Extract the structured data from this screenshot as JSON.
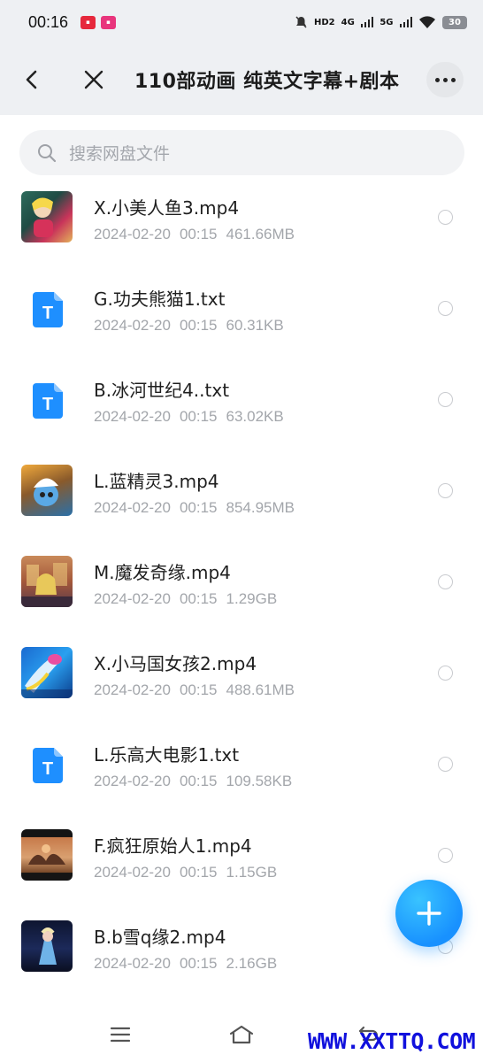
{
  "status_bar": {
    "time": "00:16",
    "indicators": [
      "HD2",
      "4G",
      "5G"
    ],
    "battery": "30"
  },
  "header": {
    "title": "110部动画 纯英文字幕+剧本",
    "back_icon": "back-arrow-icon",
    "close_icon": "close-icon",
    "more_icon": "more-dots-icon"
  },
  "search": {
    "placeholder": "搜索网盘文件"
  },
  "files": [
    {
      "name": "X.小美人鱼3.mp4",
      "date": "2024-02-20",
      "time": "00:15",
      "size": "461.66MB",
      "type": "video"
    },
    {
      "name": "G.功夫熊猫1.txt",
      "date": "2024-02-20",
      "time": "00:15",
      "size": "60.31KB",
      "type": "txt"
    },
    {
      "name": "B.冰河世纪4..txt",
      "date": "2024-02-20",
      "time": "00:15",
      "size": "63.02KB",
      "type": "txt"
    },
    {
      "name": "L.蓝精灵3.mp4",
      "date": "2024-02-20",
      "time": "00:15",
      "size": "854.95MB",
      "type": "video"
    },
    {
      "name": "M.魔发奇缘.mp4",
      "date": "2024-02-20",
      "time": "00:15",
      "size": "1.29GB",
      "type": "video"
    },
    {
      "name": "X.小马国女孩2.mp4",
      "date": "2024-02-20",
      "time": "00:15",
      "size": "488.61MB",
      "type": "video"
    },
    {
      "name": "L.乐高大电影1.txt",
      "date": "2024-02-20",
      "time": "00:15",
      "size": "109.58KB",
      "type": "txt"
    },
    {
      "name": "F.疯狂原始人1.mp4",
      "date": "2024-02-20",
      "time": "00:15",
      "size": "1.15GB",
      "type": "video"
    },
    {
      "name": "B.b雪q缘2.mp4",
      "date": "2024-02-20",
      "time": "00:15",
      "size": "2.16GB",
      "type": "video"
    }
  ],
  "fab": {
    "icon": "plus-icon"
  },
  "nav": {
    "items": [
      "menu-icon",
      "home-icon",
      "back-icon"
    ]
  },
  "watermark": "WWW.XXTTQ.COM",
  "colors": {
    "accent": "#1891ff",
    "txt_icon": "#1e8fff"
  }
}
